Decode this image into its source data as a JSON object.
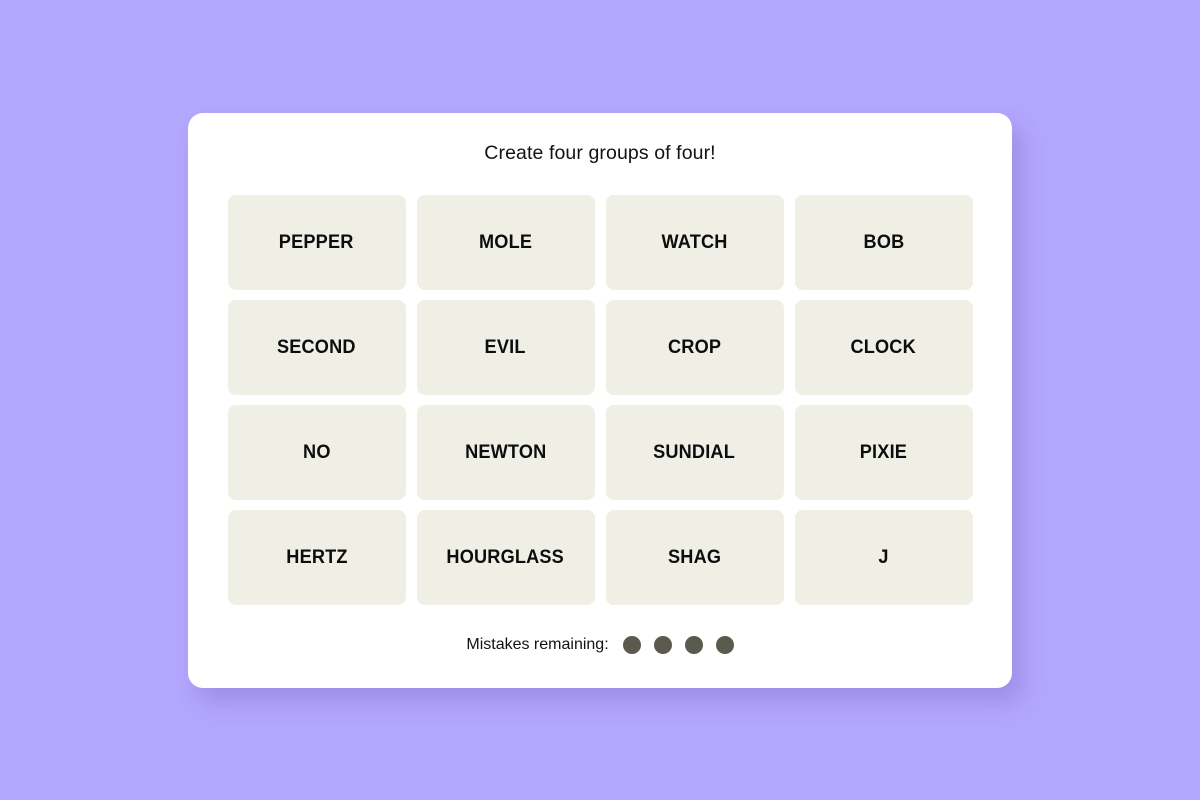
{
  "theme": {
    "page_background": "#b3a6fd",
    "card_background": "#ffffff",
    "tile_background": "#efefe6",
    "tile_text_color": "#0d0d0d",
    "mistake_dot_color": "#5a5a4f"
  },
  "game": {
    "title": "Create four groups of four!",
    "grid": {
      "columns": 4,
      "rows": 4,
      "tiles": [
        {
          "label": "PEPPER"
        },
        {
          "label": "MOLE"
        },
        {
          "label": "WATCH"
        },
        {
          "label": "BOB"
        },
        {
          "label": "SECOND"
        },
        {
          "label": "EVIL"
        },
        {
          "label": "CROP"
        },
        {
          "label": "CLOCK"
        },
        {
          "label": "NO"
        },
        {
          "label": "NEWTON"
        },
        {
          "label": "SUNDIAL"
        },
        {
          "label": "PIXIE"
        },
        {
          "label": "HERTZ"
        },
        {
          "label": "HOURGLASS"
        },
        {
          "label": "SHAG"
        },
        {
          "label": "J"
        }
      ]
    },
    "mistakes": {
      "label": "Mistakes remaining:",
      "remaining": 4,
      "dots": [
        {
          "name": "mistake-dot-1"
        },
        {
          "name": "mistake-dot-2"
        },
        {
          "name": "mistake-dot-3"
        },
        {
          "name": "mistake-dot-4"
        }
      ]
    }
  }
}
